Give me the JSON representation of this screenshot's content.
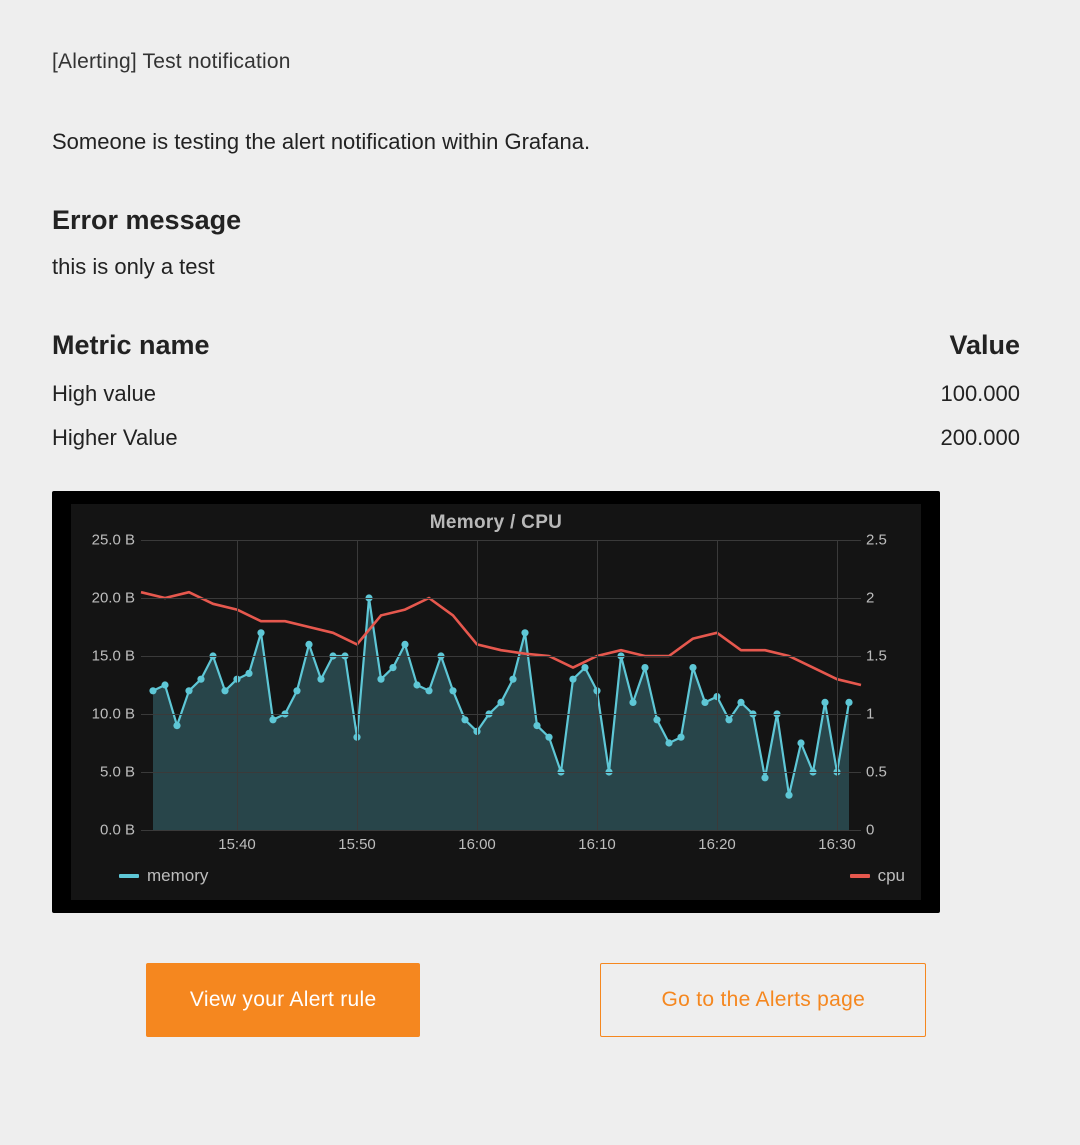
{
  "subject": "[Alerting] Test notification",
  "intro": "Someone is testing the alert notification within Grafana.",
  "error": {
    "heading": "Error message",
    "text": "this is only a test"
  },
  "metrics": {
    "head_name": "Metric name",
    "head_value": "Value",
    "rows": [
      {
        "name": "High value",
        "value": "100.000"
      },
      {
        "name": "Higher Value",
        "value": "200.000"
      }
    ]
  },
  "chart_data": {
    "type": "line",
    "title": "Memory / CPU",
    "x_ticks": [
      "15:40",
      "15:50",
      "16:00",
      "16:10",
      "16:20",
      "16:30"
    ],
    "left_axis": {
      "label": "",
      "ticks": [
        "0.0 B",
        "5.0 B",
        "10.0 B",
        "15.0 B",
        "20.0 B",
        "25.0 B"
      ],
      "lim": [
        0,
        25
      ]
    },
    "right_axis": {
      "label": "",
      "ticks": [
        "0",
        "0.5",
        "1",
        "1.5",
        "2",
        "2.5"
      ],
      "lim": [
        0,
        2.5
      ]
    },
    "x_range_minutes": [
      1532,
      1592
    ],
    "series": [
      {
        "name": "memory",
        "axis": "left",
        "color": "#5ec7d6",
        "area": true,
        "points": true,
        "x_minutes": [
          1533,
          1534,
          1535,
          1536,
          1537,
          1538,
          1539,
          1540,
          1541,
          1542,
          1543,
          1544,
          1545,
          1546,
          1547,
          1548,
          1549,
          1550,
          1551,
          1552,
          1553,
          1554,
          1555,
          1556,
          1557,
          1558,
          1559,
          1560,
          1561,
          1562,
          1563,
          1564,
          1565,
          1566,
          1567,
          1568,
          1569,
          1570,
          1571,
          1572,
          1573,
          1574,
          1575,
          1576,
          1577,
          1578,
          1579,
          1580,
          1581,
          1582,
          1583,
          1584,
          1585,
          1586,
          1587,
          1588,
          1589,
          1590,
          1591
        ],
        "values": [
          12.0,
          12.5,
          9.0,
          12.0,
          13.0,
          15.0,
          12.0,
          13.0,
          13.5,
          17.0,
          9.5,
          10.0,
          12.0,
          16.0,
          13.0,
          15.0,
          15.0,
          8.0,
          20.0,
          13.0,
          14.0,
          16.0,
          12.5,
          12.0,
          15.0,
          12.0,
          9.5,
          8.5,
          10.0,
          11.0,
          13.0,
          17.0,
          9.0,
          8.0,
          5.0,
          13.0,
          14.0,
          12.0,
          5.0,
          15.0,
          11.0,
          14.0,
          9.5,
          7.5,
          8.0,
          14.0,
          11.0,
          11.5,
          9.5,
          11.0,
          10.0,
          4.5,
          10.0,
          3.0,
          7.5,
          5.0,
          11.0,
          5.0,
          11.0
        ]
      },
      {
        "name": "cpu",
        "axis": "right",
        "color": "#e6584e",
        "area": false,
        "points": false,
        "x_minutes": [
          1532,
          1534,
          1536,
          1538,
          1540,
          1542,
          1544,
          1546,
          1548,
          1550,
          1552,
          1554,
          1556,
          1558,
          1560,
          1562,
          1564,
          1566,
          1568,
          1570,
          1572,
          1574,
          1576,
          1578,
          1580,
          1582,
          1584,
          1586,
          1588,
          1590,
          1592
        ],
        "values": [
          2.05,
          2.0,
          2.05,
          1.95,
          1.9,
          1.8,
          1.8,
          1.75,
          1.7,
          1.6,
          1.85,
          1.9,
          2.0,
          1.85,
          1.6,
          1.55,
          1.52,
          1.5,
          1.4,
          1.5,
          1.55,
          1.5,
          1.5,
          1.65,
          1.7,
          1.55,
          1.55,
          1.5,
          1.4,
          1.3,
          1.25
        ]
      }
    ],
    "legend": [
      {
        "name": "memory",
        "color": "#5ec7d6"
      },
      {
        "name": "cpu",
        "color": "#e6584e"
      }
    ]
  },
  "buttons": {
    "primary": "View your Alert rule",
    "secondary": "Go to the Alerts page"
  }
}
